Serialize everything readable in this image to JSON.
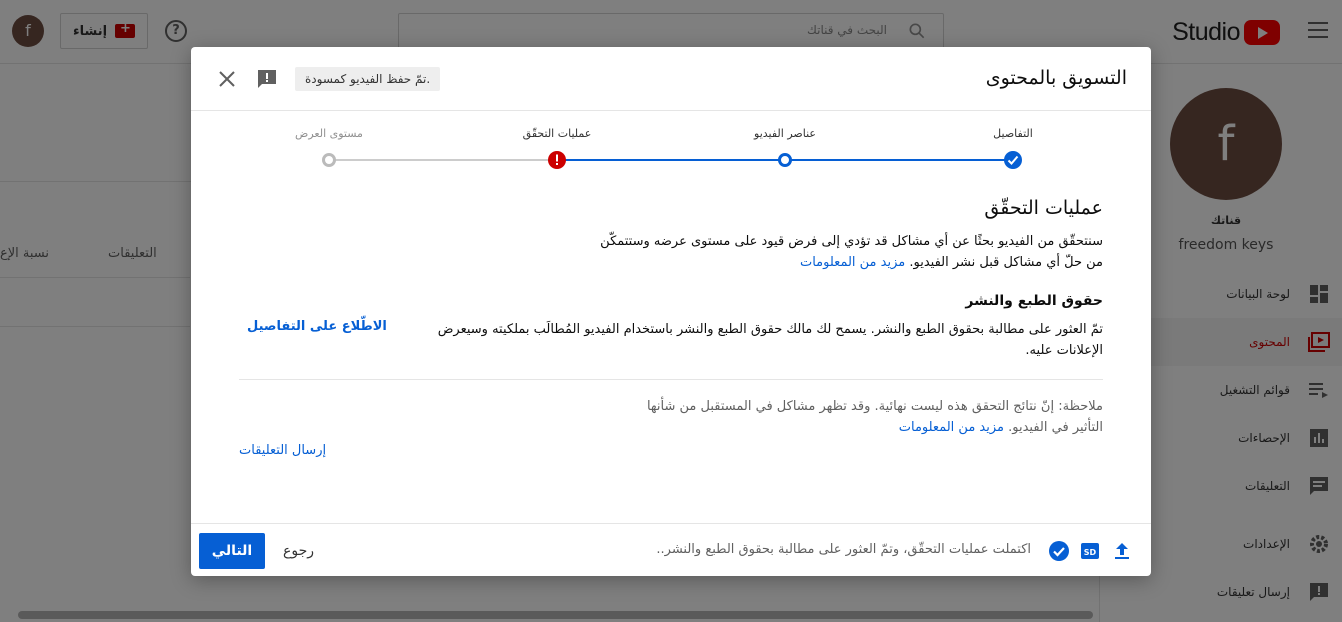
{
  "topbar": {
    "brand": "Studio",
    "search_placeholder": "البحث في قناتك",
    "create_label": "إنشاء",
    "help_glyph": "?",
    "avatar_letter": "f"
  },
  "sidebar": {
    "avatar_letter": "f",
    "channel_label": "قناتك",
    "channel_name": "freedom keys",
    "items": [
      {
        "label": "لوحة البيانات",
        "icon": "dashboard-icon"
      },
      {
        "label": "المحتوى",
        "icon": "content-icon",
        "active": true
      },
      {
        "label": "قوائم التشغيل",
        "icon": "playlist-icon"
      },
      {
        "label": "الإحصاءات",
        "icon": "analytics-icon"
      },
      {
        "label": "التعليقات",
        "icon": "comments-icon"
      },
      {
        "label": "الإعدادات",
        "icon": "settings-icon"
      },
      {
        "label": "إرسال تعليقات",
        "icon": "feedback-icon"
      }
    ]
  },
  "table": {
    "col_comments": "التعليقات",
    "col_ratio": "نسبة الإع"
  },
  "dialog": {
    "title": "التسويق بالمحتوى",
    "draft_status": "تمّ حفظ الفيديو كمسودة.",
    "steps": [
      {
        "label": "التفاصيل",
        "state": "done"
      },
      {
        "label": "عناصر الفيديو",
        "state": "current"
      },
      {
        "label": "عمليات التحقّق",
        "state": "error"
      },
      {
        "label": "مستوى العرض",
        "state": "pending"
      }
    ],
    "checks": {
      "heading": "عمليات التحقّق",
      "intro": "سنتحقّق من الفيديو بحثًا عن أي مشاكل قد تؤدي إلى فرض قيود على مستوى عرضه وستتمكّن من حلّ أي مشاكل قبل نشر الفيديو.",
      "learn_more": "مزيد من المعلومات",
      "copyright_heading": "حقوق الطبع والنشر",
      "copyright_text": "تمّ العثور على مطالبة بحقوق الطبع والنشر. يسمح لك مالك حقوق الطبع والنشر باستخدام الفيديو المُطالَب بملكيته وسيعرض الإعلانات عليه.",
      "view_details": "الاطّلاع على التفاصيل",
      "note": "ملاحظة: إنّ نتائج التحقق هذه ليست نهائية. وقد تظهر مشاكل في المستقبل من شأنها التأثير في الفيديو.",
      "note_learn_more": "مزيد من المعلومات",
      "send_feedback": "إرسال التعليقات"
    },
    "footer": {
      "status": "اكتملت عمليات التحقّق، وتمّ العثور على مطالبة بحقوق الطبع والنشر..",
      "sd_badge": "SD",
      "back_label": "رجوع",
      "next_label": "التالي"
    }
  },
  "colors": {
    "accent": "#065fd4",
    "error": "#cc0000",
    "brand_red": "#ff0000"
  }
}
